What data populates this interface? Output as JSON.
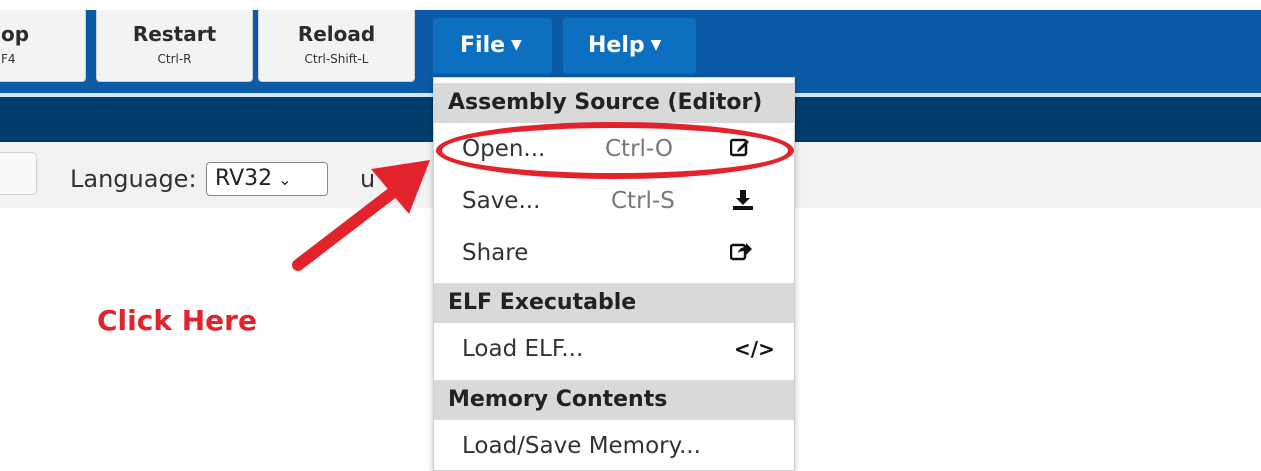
{
  "toolbar": {
    "stop": {
      "label": "op",
      "shortcut": "F4"
    },
    "restart": {
      "label": "Restart",
      "shortcut": "Ctrl-R"
    },
    "reload": {
      "label": "Reload",
      "shortcut": "Ctrl-Shift-L"
    }
  },
  "menu": {
    "file": "File",
    "help": "Help"
  },
  "settings": {
    "language_label": "Language:",
    "language_value": "RV32",
    "next_text": "u"
  },
  "dropdown": {
    "sections": [
      {
        "header": "Assembly Source (Editor)",
        "items": [
          {
            "label": "Open...",
            "shortcut": "Ctrl-O",
            "icon": "edit-icon"
          },
          {
            "label": "Save...",
            "shortcut": "Ctrl-S",
            "icon": "download-icon"
          },
          {
            "label": "Share",
            "shortcut": "",
            "icon": "share-icon"
          }
        ]
      },
      {
        "header": "ELF Executable",
        "items": [
          {
            "label": "Load ELF...",
            "shortcut": "",
            "icon": "code-icon"
          }
        ]
      },
      {
        "header": "Memory Contents",
        "items": [
          {
            "label": "Load/Save Memory...",
            "shortcut": "",
            "icon": ""
          }
        ]
      }
    ]
  },
  "annotation": {
    "text": "Click Here",
    "color": "#e2232b"
  },
  "colors": {
    "topbar": "#0a5aa6",
    "menu_button": "#0c6fc0",
    "navbar": "#003c6c",
    "annotation": "#e2232b"
  }
}
